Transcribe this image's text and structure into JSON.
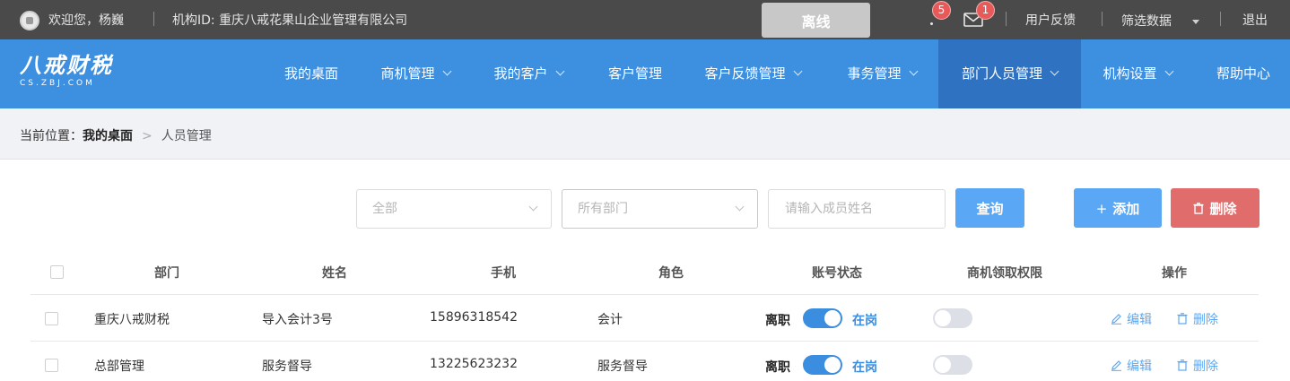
{
  "topbar": {
    "welcome": "欢迎您，杨巍",
    "org": "机构ID: 重庆八戒花果山企业管理有限公司",
    "offline_label": "离线",
    "notify_count": "5",
    "mail_count": "1",
    "feedback": "用户反馈",
    "filter": "筛选数据",
    "logout": "退出"
  },
  "logo": {
    "main": "八戒财税",
    "sub": "CS.ZBJ.COM"
  },
  "nav": {
    "items": [
      {
        "label": "我的桌面",
        "dropdown": false
      },
      {
        "label": "商机管理",
        "dropdown": true
      },
      {
        "label": "我的客户",
        "dropdown": true
      },
      {
        "label": "客户管理",
        "dropdown": false
      },
      {
        "label": "客户反馈管理",
        "dropdown": true
      },
      {
        "label": "事务管理",
        "dropdown": true
      },
      {
        "label": "部门人员管理",
        "dropdown": true,
        "active": true
      },
      {
        "label": "机构设置",
        "dropdown": true
      },
      {
        "label": "帮助中心",
        "dropdown": false
      }
    ]
  },
  "breadcrumb": {
    "prefix": "当前位置：",
    "home": "我的桌面",
    "arrow": ">",
    "current": "人员管理"
  },
  "filters": {
    "status_select": "全部",
    "dept_select": "所有部门",
    "name_placeholder": "请输入成员姓名",
    "query_label": "查询",
    "add_label": "添加",
    "delete_label": "删除"
  },
  "table": {
    "headers": [
      "部门",
      "姓名",
      "手机",
      "角色",
      "账号状态",
      "商机领取权限",
      "操作"
    ],
    "status_off": "离职",
    "status_on": "在岗",
    "edit_label": "编辑",
    "delete_label": "删除",
    "rows": [
      {
        "dept": "重庆八戒财税",
        "name": "导入会计3号",
        "phone": "15896318542",
        "role": "会计",
        "active": true,
        "permission": false
      },
      {
        "dept": "总部管理",
        "name": "服务督导",
        "phone": "13225623232",
        "role": "服务督导",
        "active": true,
        "permission": false
      }
    ]
  },
  "colors": {
    "nav_bg": "#3d8fe0",
    "nav_active": "#2e72c1",
    "accent": "#5aa8f5",
    "danger": "#e06c6c",
    "topbar_bg": "#4a4a4a"
  }
}
